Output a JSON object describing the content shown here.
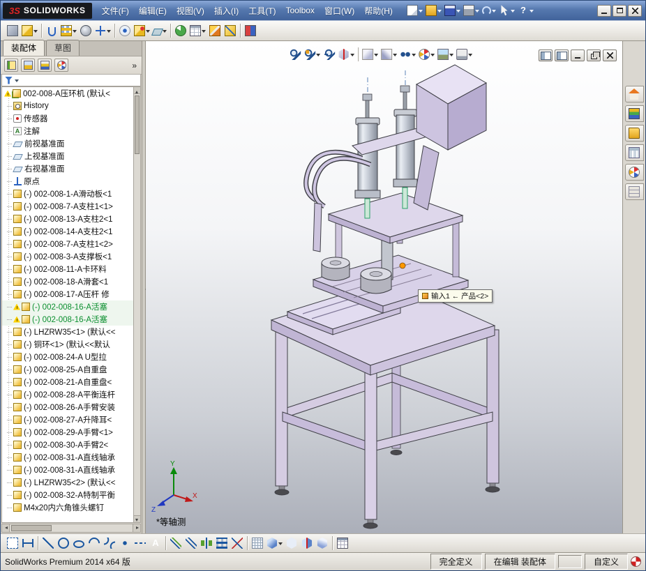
{
  "titlebar": {
    "brand_mark": "3S",
    "brand_name": "SOLIDWORKS",
    "menus": [
      "文件(F)",
      "编辑(E)",
      "视图(V)",
      "插入(I)",
      "工具(T)",
      "Toolbox",
      "窗口(W)",
      "帮助(H)"
    ],
    "buttons": [
      {
        "name": "new",
        "dropdown": true
      },
      {
        "name": "open",
        "dropdown": true
      },
      {
        "name": "save",
        "dropdown": true
      },
      {
        "name": "print",
        "dropdown": true
      },
      {
        "name": "undo",
        "dropdown": true
      },
      {
        "name": "select",
        "dropdown": true
      },
      {
        "name": "help",
        "dropdown": true,
        "glyph": "?"
      }
    ]
  },
  "main_toolbar": {
    "buttons": [
      "edit-component",
      {
        "name": "insert-components",
        "dropdown": true
      },
      "|",
      "mate",
      {
        "name": "linear-component-pattern",
        "dropdown": true
      },
      "smart-fasteners",
      {
        "name": "move-component",
        "dropdown": true
      },
      "|",
      "show-hidden-components",
      {
        "name": "assembly-features",
        "dropdown": true
      },
      {
        "name": "reference-geometry",
        "dropdown": true
      },
      "|",
      "new-motion-study",
      {
        "name": "bill-of-materials",
        "dropdown": true
      },
      "exploded-view",
      "explode-line-sketch",
      "|",
      "interference-detection"
    ]
  },
  "left_panel": {
    "tabs": [
      {
        "label": "装配体",
        "active": true
      },
      {
        "label": "草图",
        "active": false
      }
    ],
    "overflow": "»",
    "tree": {
      "items": [
        {
          "level": 0,
          "icon": "assembly",
          "warning": true,
          "label": "002-008-A压环机 (默认<"
        },
        {
          "level": 1,
          "icon": "history",
          "label": "History"
        },
        {
          "level": 1,
          "icon": "sensor",
          "label": "传感器"
        },
        {
          "level": 1,
          "icon": "annotation",
          "label": "注解"
        },
        {
          "level": 1,
          "icon": "plane",
          "label": "前视基准面"
        },
        {
          "level": 1,
          "icon": "plane",
          "label": "上视基准面"
        },
        {
          "level": 1,
          "icon": "plane",
          "label": "右视基准面"
        },
        {
          "level": 1,
          "icon": "origin",
          "label": "原点"
        },
        {
          "level": 1,
          "icon": "part",
          "label": "(-) 002-008-1-A滑动板<1"
        },
        {
          "level": 1,
          "icon": "part",
          "label": "(-) 002-008-7-A支柱1<1>"
        },
        {
          "level": 1,
          "icon": "part",
          "label": "(-) 002-008-13-A支柱2<1"
        },
        {
          "level": 1,
          "icon": "part",
          "label": "(-) 002-008-14-A支柱2<1"
        },
        {
          "level": 1,
          "icon": "part",
          "label": "(-) 002-008-7-A支柱1<2>"
        },
        {
          "level": 1,
          "icon": "part",
          "label": "(-) 002-008-3-A支撑板<1"
        },
        {
          "level": 1,
          "icon": "part",
          "label": "(-) 002-008-11-A卡环料"
        },
        {
          "level": 1,
          "icon": "part",
          "label": "(-) 002-008-18-A滑套<1"
        },
        {
          "level": 1,
          "icon": "part",
          "label": "(-) 002-008-17-A压杆 修"
        },
        {
          "level": 1,
          "icon": "part",
          "warning": true,
          "selected": true,
          "label": "(-) 002-008-16-A活塞"
        },
        {
          "level": 1,
          "icon": "part",
          "warning": true,
          "selected": true,
          "label": "(-) 002-008-16-A活塞"
        },
        {
          "level": 1,
          "icon": "part",
          "label": "(-) LHZRW35<1> (默认<<"
        },
        {
          "level": 1,
          "icon": "part",
          "label": "(-) 铜环<1> (默认<<默认"
        },
        {
          "level": 1,
          "icon": "part",
          "label": "(-) 002-008-24-A U型拉"
        },
        {
          "level": 1,
          "icon": "part",
          "label": "(-) 002-008-25-A自重盘"
        },
        {
          "level": 1,
          "icon": "part",
          "label": "(-) 002-008-21-A自重盘<"
        },
        {
          "level": 1,
          "icon": "part",
          "label": "(-) 002-008-28-A平衡连杆"
        },
        {
          "level": 1,
          "icon": "part",
          "label": "(-) 002-008-26-A手臂安装"
        },
        {
          "level": 1,
          "icon": "part",
          "label": "(-) 002-008-27-A升降耳<"
        },
        {
          "level": 1,
          "icon": "part",
          "label": "(-) 002-008-29-A手臂<1>"
        },
        {
          "level": 1,
          "icon": "part",
          "label": "(-) 002-008-30-A手臂2<"
        },
        {
          "level": 1,
          "icon": "part",
          "label": "(-) 002-008-31-A直线轴承"
        },
        {
          "level": 1,
          "icon": "part",
          "label": "(-) 002-008-31-A直线轴承"
        },
        {
          "level": 1,
          "icon": "part",
          "label": "(-) LHZRW35<2> (默认<<"
        },
        {
          "level": 1,
          "icon": "part",
          "label": "(-) 002-008-32-A特制平衡"
        },
        {
          "level": 1,
          "icon": "part",
          "label": "M4x20内六角锥头螺钉"
        }
      ]
    }
  },
  "headsup_toolbar": {
    "buttons": [
      "zoom-fit",
      {
        "name": "zoom-area",
        "dropdown": true
      },
      "previous-view",
      {
        "name": "section-view",
        "dropdown": true
      },
      "|",
      {
        "name": "view-orientation",
        "dropdown": true
      },
      {
        "name": "display-style",
        "dropdown": true
      },
      {
        "name": "hide-show-items",
        "dropdown": true
      },
      {
        "name": "edit-appearance",
        "dropdown": true
      },
      {
        "name": "apply-scene",
        "dropdown": true
      },
      {
        "name": "view-settings",
        "dropdown": true
      }
    ]
  },
  "task_pane": {
    "buttons": [
      "solidworks-resources",
      "design-library",
      "file-explorer",
      "view-palette",
      "appearances-scenes",
      "custom-properties"
    ]
  },
  "bottom_toolbar": {
    "buttons": [
      "sketch",
      "smart-dimension",
      "|",
      "line",
      "circle",
      "ellipse",
      "arc",
      "spline",
      "point",
      "centerline",
      {
        "name": "text",
        "glyph": "A"
      },
      "|",
      "convert-entities",
      "offset-entities",
      "mirror-entities",
      "linear-sketch-pattern",
      "trim-entities",
      "|",
      "grid-snap",
      {
        "name": "shaded-view",
        "dropdown": true
      },
      "wireframe-view",
      "section-cube",
      "isometric-view",
      "|",
      "design-table"
    ]
  },
  "viewport": {
    "view_label": "*等轴测",
    "callout": "输入1 ← 产品<2>",
    "triad": {
      "x": "X",
      "y": "Y",
      "z": "Z"
    }
  },
  "statusbar": {
    "app": "SolidWorks Premium 2014 x64 版",
    "fully_defined": "完全定义",
    "editing": "在编辑 装配体",
    "custom": "自定义"
  }
}
